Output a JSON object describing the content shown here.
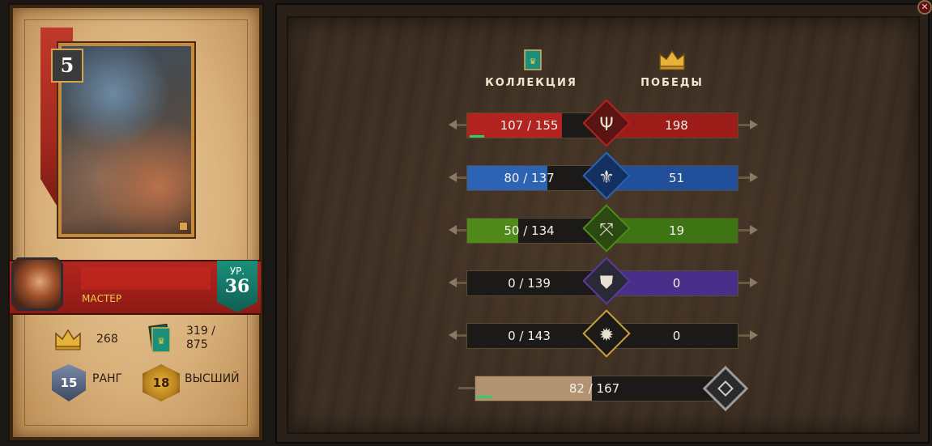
{
  "card": {
    "strength": "5"
  },
  "player": {
    "title": "МАСТЕР",
    "level_label": "УР.",
    "level": "36"
  },
  "stats": {
    "crowns": "268",
    "cards_owned": "319 /",
    "cards_total": "875",
    "rank_label": "РАНГ",
    "rank_value": "15",
    "tier_label": "ВЫСШИЙ",
    "tier_value": "18"
  },
  "headers": {
    "collection": "КОЛЛЕКЦИЯ",
    "victories": "ПОБЕДЫ"
  },
  "factions": [
    {
      "emblem": "monsters-icon",
      "collection_text": "107 / 155",
      "collected": 107,
      "total": 155,
      "wins": "198",
      "color": "#b3231f",
      "win_color": "#9c1c19",
      "glyph": "Ψ"
    },
    {
      "emblem": "northern-realms-icon",
      "collection_text": "80 / 137",
      "collected": 80,
      "total": 137,
      "wins": "51",
      "color": "#2d63b5",
      "win_color": "#224f99",
      "glyph": "⚜"
    },
    {
      "emblem": "scoiatael-icon",
      "collection_text": "50 / 134",
      "collected": 50,
      "total": 134,
      "wins": "19",
      "color": "#4f8a1a",
      "win_color": "#3e7413",
      "glyph": "⤧"
    },
    {
      "emblem": "skellige-icon",
      "collection_text": "0 / 139",
      "collected": 0,
      "total": 139,
      "wins": "0",
      "color": "#5b3a9e",
      "win_color": "#4a2f8a",
      "glyph": "⛊"
    },
    {
      "emblem": "nilfgaard-icon",
      "collection_text": "0 / 143",
      "collected": 0,
      "total": 143,
      "wins": "0",
      "color": "#c9a03a",
      "win_color": "#1c1a18",
      "glyph": "✹"
    }
  ],
  "overall": {
    "text": "82 / 167",
    "collected": 82,
    "total": 167
  }
}
